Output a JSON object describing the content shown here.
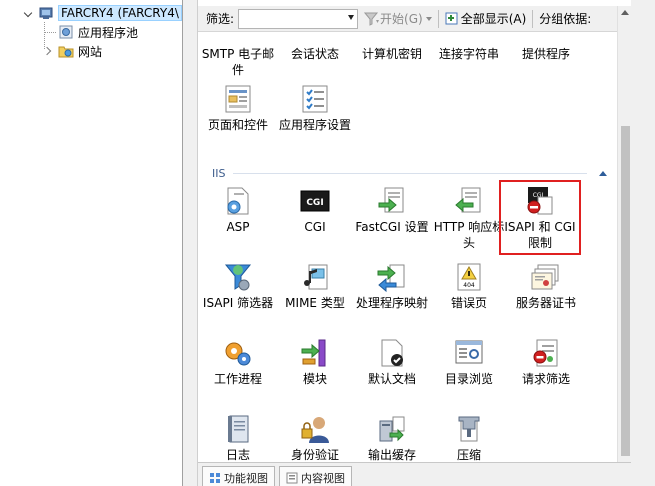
{
  "tree": {
    "server_label": "FARCRY4 (FARCRY4\\",
    "app_pools_label": "应用程序池",
    "sites_label": "网站"
  },
  "filterbar": {
    "filter_label": "筛选:",
    "filter_value": "",
    "start_label": "开始(G)",
    "show_all_label": "全部显示(A)",
    "group_by_label": "分组依据:"
  },
  "features": {
    "top_row": [
      "SMTP 电子邮件",
      "会话状态",
      "计算机密钥",
      "连接字符串",
      "提供程序"
    ],
    "second_row": [
      "页面和控件",
      "应用程序设置"
    ],
    "section_title": "IIS",
    "iis_rows": [
      [
        "ASP",
        "CGI",
        "FastCGI 设置",
        "HTTP 响应标头",
        "ISAPI 和 CGI 限制"
      ],
      [
        "ISAPI 筛选器",
        "MIME 类型",
        "处理程序映射",
        "错误页",
        "服务器证书"
      ],
      [
        "工作进程",
        "模块",
        "默认文档",
        "目录浏览",
        "请求筛选"
      ],
      [
        "日志",
        "身份验证",
        "输出缓存",
        "压缩"
      ]
    ],
    "highlighted": "ISAPI 和 CGI 限制"
  },
  "bottom_tabs": [
    "功能视图",
    "内容视图"
  ],
  "colors": {
    "highlight_border": "#e02020",
    "section_header": "#3c5c8c",
    "selection": "#cde8ff"
  }
}
